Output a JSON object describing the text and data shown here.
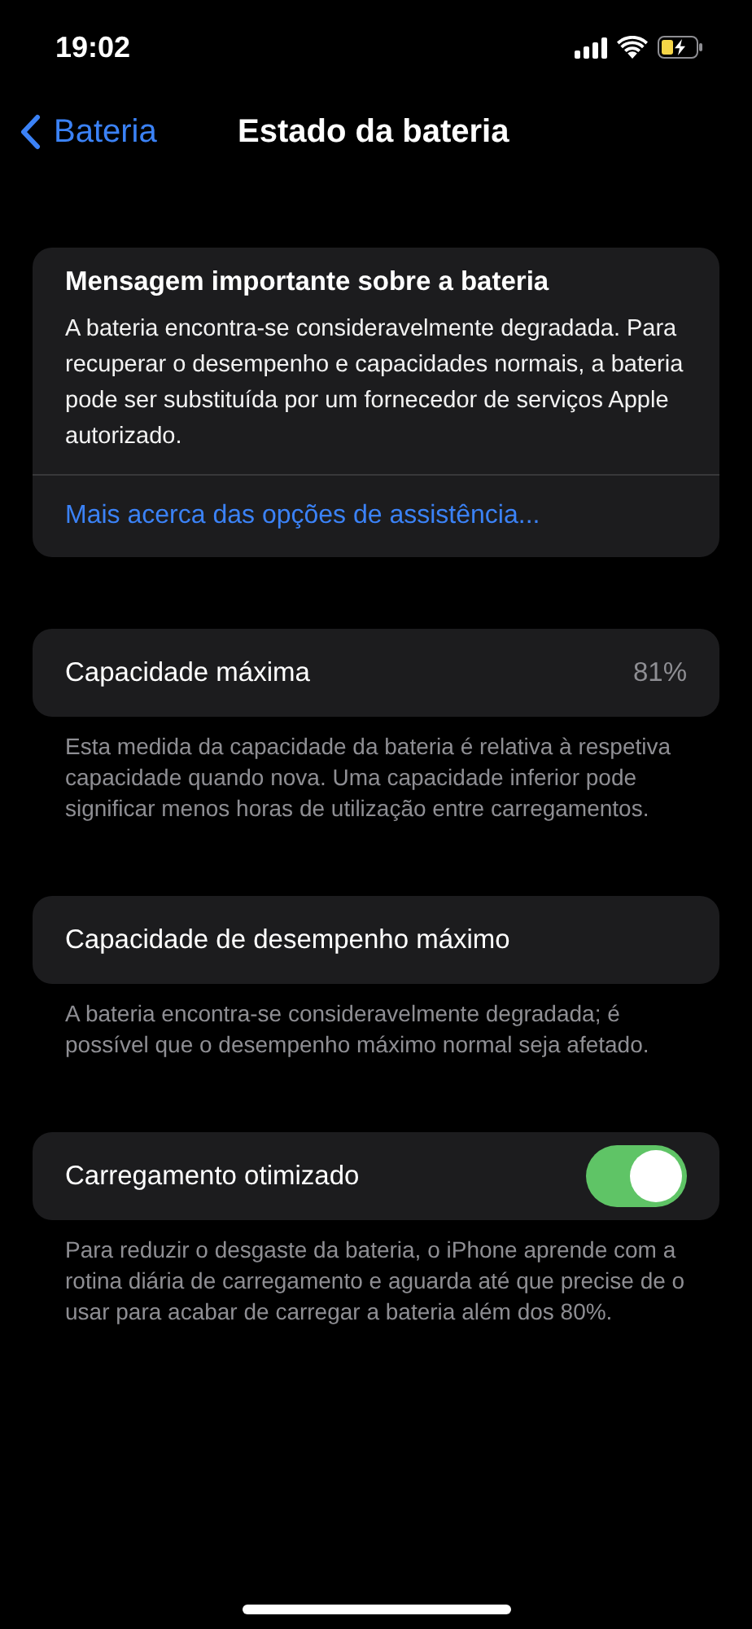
{
  "status_bar": {
    "time": "19:02"
  },
  "nav": {
    "back": "Bateria",
    "title": "Estado da bateria"
  },
  "message_card": {
    "title": "Mensagem importante sobre a bateria",
    "body": "A bateria encontra-se consideravelmente degradada. Para recuperar o desempenho e capacidades normais, a bateria pode ser substituída por um fornecedor de serviços Apple autorizado.",
    "link": "Mais acerca das opções de assistência..."
  },
  "sections": [
    {
      "kind": "value",
      "label": "Capacidade máxima",
      "value": "81%",
      "footer": "Esta medida da capacidade da bateria é relativa à respetiva capacidade quando nova. Uma capacidade inferior pode significar menos horas de utilização entre carregamentos."
    },
    {
      "kind": "plain",
      "label": "Capacidade de desempenho máximo",
      "footer": "A bateria encontra-se consideravelmente degradada; é possível que o desempenho máximo normal seja afetado."
    },
    {
      "kind": "toggle",
      "label": "Carregamento otimizado",
      "on": true,
      "footer": "Para reduzir o desgaste da bateria, o iPhone aprende com a rotina diária de carregamento e aguarda até que precise de o usar para acabar de carregar a bateria além dos 80%."
    }
  ]
}
